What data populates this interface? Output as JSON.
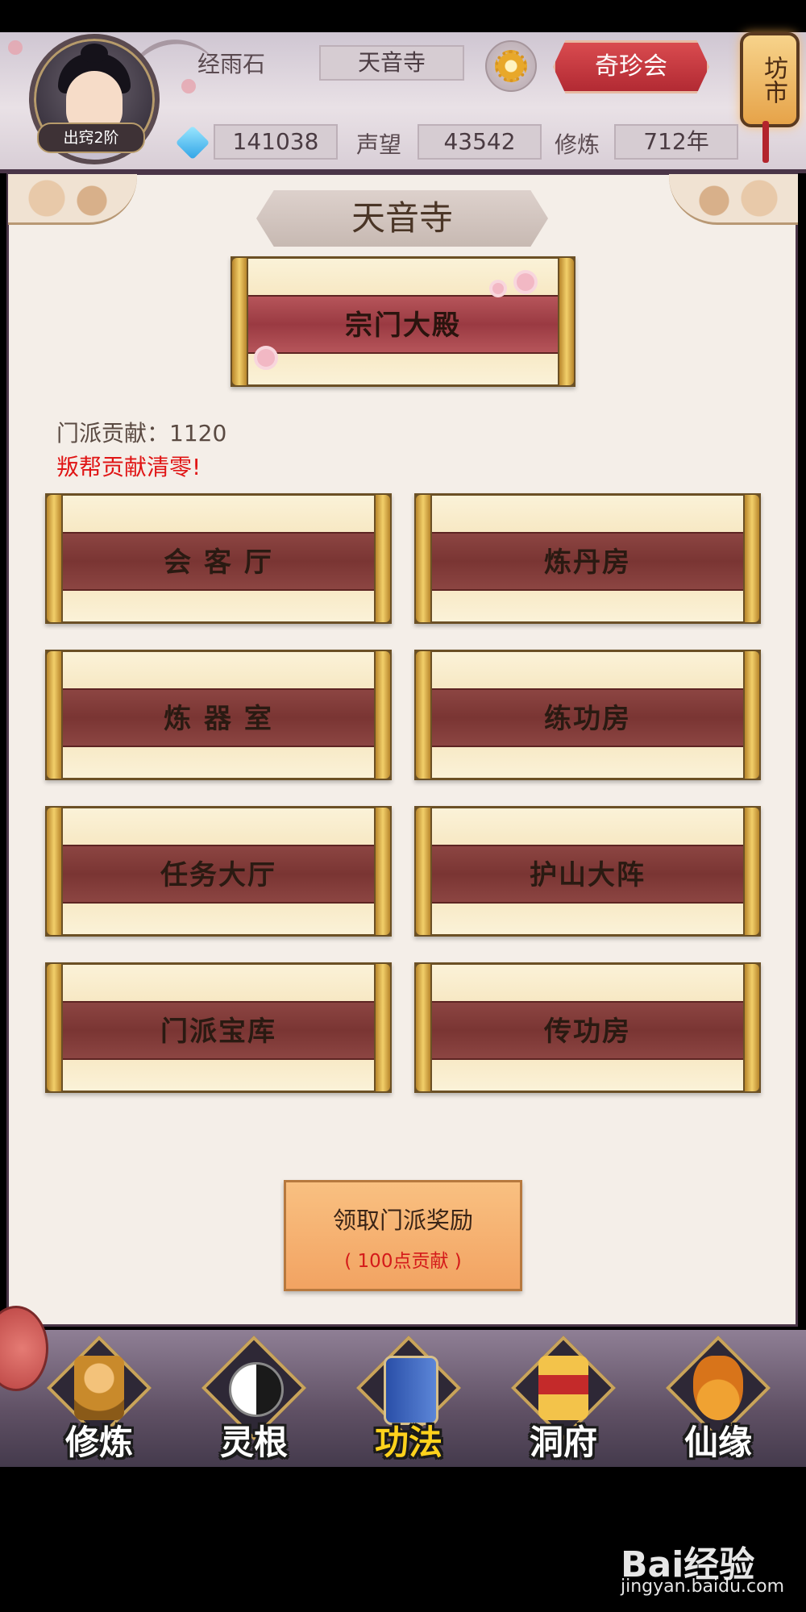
{
  "header": {
    "resource_label": "经雨石",
    "sect_name": "天音寺",
    "treasure_button": "奇珍会",
    "market_lantern": "坊市",
    "rank_badge": "出窍2阶",
    "spirit_stones": "141038",
    "reputation_label": "声望",
    "reputation_value": "43542",
    "cultivation_label": "修炼",
    "cultivation_value": "712年"
  },
  "panel": {
    "title": "天音寺",
    "main_hall": "宗门大殿",
    "contribution": "门派贡献：1120",
    "warning": "叛帮贡献清零!",
    "buildings": [
      "会 客 厅",
      "炼丹房",
      "炼 器 室",
      "练功房",
      "任务大厅",
      "护山大阵",
      "门派宝库",
      "传功房"
    ],
    "reward_title": "领取门派奖励",
    "reward_cost": "( 100点贡献 )"
  },
  "nav": {
    "items": [
      {
        "label": "修炼",
        "icon": "monk-icon"
      },
      {
        "label": "灵根",
        "icon": "yin-yang-sword-icon"
      },
      {
        "label": "功法",
        "icon": "book-icon"
      },
      {
        "label": "洞府",
        "icon": "pagoda-icon"
      },
      {
        "label": "仙缘",
        "icon": "gourd-icon"
      }
    ],
    "active": "功法"
  },
  "watermark": {
    "logo": "Bai经验",
    "url": "jingyan.baidu.com"
  },
  "colors": {
    "accent_red": "#b22a33",
    "warning_red": "#e01515",
    "active_nav": "#ffd21c",
    "scroll_band": "#7a3533"
  }
}
